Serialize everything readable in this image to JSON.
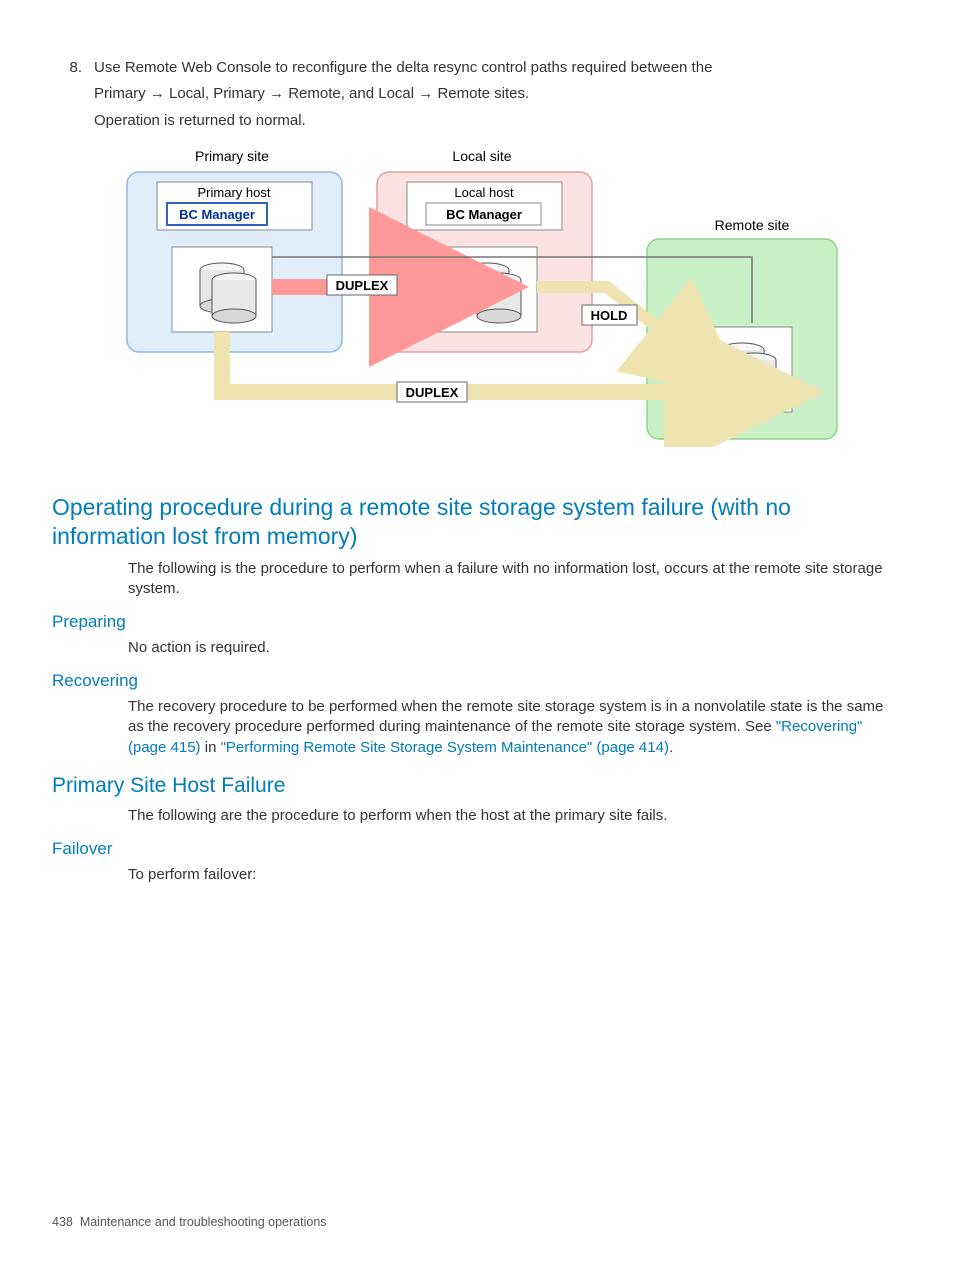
{
  "step": {
    "num": "8.",
    "line1_a": "Use Remote Web Console to reconfigure the delta resync control paths required between the",
    "line1_b": "Primary → Local, Primary → Remote, and Local → Remote sites.",
    "line2": "Operation is returned to normal."
  },
  "diagram": {
    "primary_site": "Primary site",
    "local_site": "Local site",
    "remote_site": "Remote site",
    "primary_host": "Primary host",
    "local_host": "Local host",
    "bc_manager": "BC Manager",
    "duplex": "DUPLEX",
    "hold": "HOLD"
  },
  "sec1": {
    "title": "Operating procedure during a remote site storage system failure (with no information lost from memory)",
    "body": "The following is the procedure to perform when a failure with no information lost, occurs at the remote site storage system."
  },
  "prep": {
    "title": "Preparing",
    "body": "No action is required."
  },
  "rec": {
    "title": "Recovering",
    "body_a": "The recovery procedure to be performed when the remote site storage system is in a nonvolatile state is the same as the recovery procedure performed during maintenance of the remote site storage system. See ",
    "link1": "\"Recovering\" (page 415)",
    "body_b": " in ",
    "link2": "\"Performing Remote Site Storage System Maintenance\" (page 414)",
    "body_c": "."
  },
  "sec2": {
    "title": "Primary Site Host Failure",
    "body": "The following are the procedure to perform when the host at the primary site fails."
  },
  "fail": {
    "title": "Failover",
    "body": "To perform failover:"
  },
  "footer": {
    "page": "438",
    "text": "Maintenance and troubleshooting operations"
  }
}
